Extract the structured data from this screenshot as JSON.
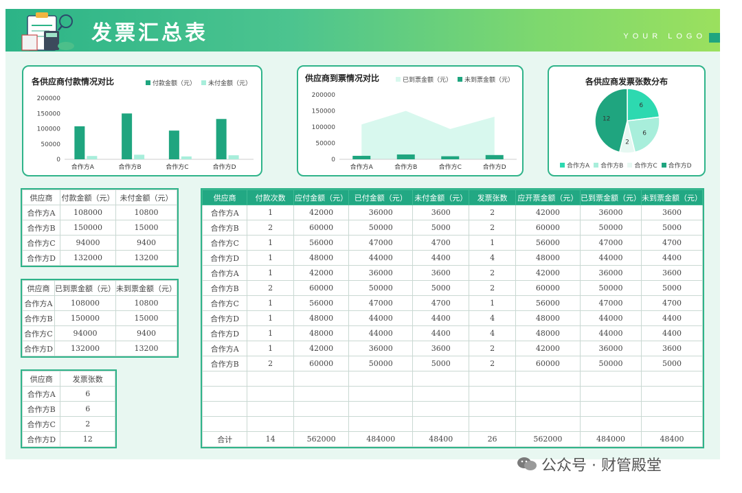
{
  "header": {
    "title": "发票汇总表",
    "logo": "YOUR LOGO"
  },
  "colors": {
    "dark": "#1fa57f",
    "light": "#a8eedb",
    "mid": "#2dd9b0",
    "pale": "#d8f8ee"
  },
  "charts": {
    "payment": {
      "title": "各供应商付款情况对比",
      "legend": [
        "付款金额（元）",
        "未付金额（元）"
      ],
      "yticks": [
        "200000",
        "150000",
        "100000",
        "50000",
        "0"
      ]
    },
    "invoice": {
      "title": "供应商到票情况对比",
      "legend": [
        "已到票金额（元）",
        "未到票金额（元）"
      ],
      "yticks": [
        "200000",
        "150000",
        "100000",
        "50000",
        "0"
      ]
    },
    "count": {
      "title": "各供应商发票张数分布",
      "legend": [
        "合作方A",
        "合作方B",
        "合作方C",
        "合作方D"
      ],
      "labels": [
        "6",
        "6",
        "2",
        "12"
      ]
    }
  },
  "chart_data": [
    {
      "type": "bar",
      "title": "各供应商付款情况对比",
      "categories": [
        "合作方A",
        "合作方B",
        "合作方C",
        "合作方D"
      ],
      "series": [
        {
          "name": "付款金额（元）",
          "values": [
            108000,
            150000,
            94000,
            132000
          ]
        },
        {
          "name": "未付金额（元）",
          "values": [
            10800,
            15000,
            9400,
            13200
          ]
        }
      ],
      "ylim": [
        0,
        200000
      ]
    },
    {
      "type": "area",
      "title": "供应商到票情况对比",
      "categories": [
        "合作方A",
        "合作方B",
        "合作方C",
        "合作方D"
      ],
      "series": [
        {
          "name": "已到票金额（元）",
          "values": [
            108000,
            150000,
            94000,
            132000
          ]
        },
        {
          "name": "未到票金额（元）",
          "values": [
            10800,
            15000,
            9400,
            13200
          ]
        }
      ],
      "ylim": [
        0,
        200000
      ]
    },
    {
      "type": "pie",
      "title": "各供应商发票张数分布",
      "categories": [
        "合作方A",
        "合作方B",
        "合作方C",
        "合作方D"
      ],
      "values": [
        6,
        6,
        2,
        12
      ]
    }
  ],
  "table1": {
    "headers": [
      "供应商",
      "付款金额（元）",
      "未付金额（元）"
    ],
    "rows": [
      [
        "合作方A",
        "108000",
        "10800"
      ],
      [
        "合作方B",
        "150000",
        "15000"
      ],
      [
        "合作方C",
        "94000",
        "9400"
      ],
      [
        "合作方D",
        "132000",
        "13200"
      ]
    ]
  },
  "table2": {
    "headers": [
      "供应商",
      "已到票金额（元）",
      "未到票金额（元）"
    ],
    "rows": [
      [
        "合作方A",
        "108000",
        "10800"
      ],
      [
        "合作方B",
        "150000",
        "15000"
      ],
      [
        "合作方C",
        "94000",
        "9400"
      ],
      [
        "合作方D",
        "132000",
        "13200"
      ]
    ]
  },
  "table3": {
    "headers": [
      "供应商",
      "发票张数"
    ],
    "rows": [
      [
        "合作方A",
        "6"
      ],
      [
        "合作方B",
        "6"
      ],
      [
        "合作方C",
        "2"
      ],
      [
        "合作方D",
        "12"
      ]
    ]
  },
  "main_table": {
    "headers": [
      "供应商",
      "付款次数",
      "应付金额（元）",
      "已付金额（元）",
      "未付金额（元）",
      "发票张数",
      "应开票金额（元）",
      "已到票金额（元）",
      "未到票金额（元）"
    ],
    "rows": [
      [
        "合作方A",
        "1",
        "42000",
        "36000",
        "3600",
        "2",
        "42000",
        "36000",
        "3600"
      ],
      [
        "合作方B",
        "2",
        "60000",
        "50000",
        "5000",
        "2",
        "60000",
        "50000",
        "5000"
      ],
      [
        "合作方C",
        "1",
        "56000",
        "47000",
        "4700",
        "1",
        "56000",
        "47000",
        "4700"
      ],
      [
        "合作方D",
        "1",
        "48000",
        "44000",
        "4400",
        "4",
        "48000",
        "44000",
        "4400"
      ],
      [
        "合作方A",
        "1",
        "42000",
        "36000",
        "3600",
        "2",
        "42000",
        "36000",
        "3600"
      ],
      [
        "合作方B",
        "2",
        "60000",
        "50000",
        "5000",
        "2",
        "60000",
        "50000",
        "5000"
      ],
      [
        "合作方C",
        "1",
        "56000",
        "47000",
        "4700",
        "1",
        "56000",
        "47000",
        "4700"
      ],
      [
        "合作方D",
        "1",
        "48000",
        "44000",
        "4400",
        "4",
        "48000",
        "44000",
        "4400"
      ],
      [
        "合作方D",
        "1",
        "48000",
        "44000",
        "4400",
        "4",
        "48000",
        "44000",
        "4400"
      ],
      [
        "合作方A",
        "1",
        "42000",
        "36000",
        "3600",
        "2",
        "42000",
        "36000",
        "3600"
      ],
      [
        "合作方B",
        "2",
        "60000",
        "50000",
        "5000",
        "2",
        "60000",
        "50000",
        "5000"
      ],
      [
        "",
        "",
        "",
        "",
        "",
        "",
        "",
        "",
        ""
      ],
      [
        "",
        "",
        "",
        "",
        "",
        "",
        "",
        "",
        ""
      ],
      [
        "",
        "",
        "",
        "",
        "",
        "",
        "",
        "",
        ""
      ],
      [
        "",
        "",
        "",
        "",
        "",
        "",
        "",
        "",
        ""
      ]
    ],
    "total": [
      "合计",
      "14",
      "562000",
      "484000",
      "48400",
      "26",
      "562000",
      "484000",
      "48400"
    ]
  },
  "watermark": "公众号 · 财管殿堂"
}
